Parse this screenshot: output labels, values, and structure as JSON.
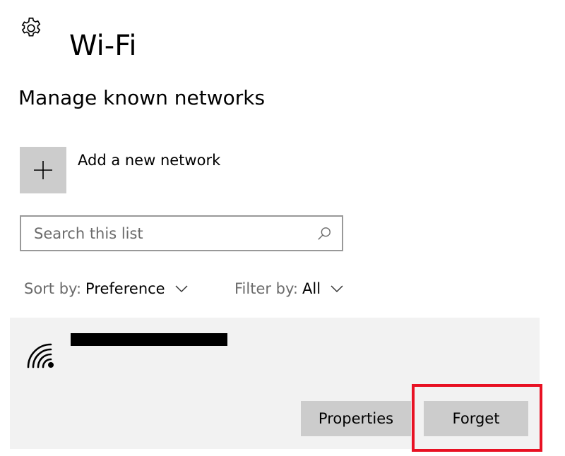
{
  "header": {
    "title": "Wi-Fi",
    "icon": "gear-icon"
  },
  "section": {
    "heading": "Manage known networks"
  },
  "add_network": {
    "label": "Add a new network",
    "icon": "plus-icon"
  },
  "search": {
    "placeholder": "Search this list",
    "value": "",
    "icon": "search-icon"
  },
  "sort": {
    "label": "Sort by:",
    "value": "Preference"
  },
  "filter": {
    "label": "Filter by:",
    "value": "All"
  },
  "network": {
    "name": "",
    "icon": "wifi-secured-icon",
    "actions": {
      "properties_label": "Properties",
      "forget_label": "Forget"
    }
  },
  "colors": {
    "highlight": "#e81123",
    "card_background": "#f2f2f2",
    "button_background": "#cccccc"
  }
}
